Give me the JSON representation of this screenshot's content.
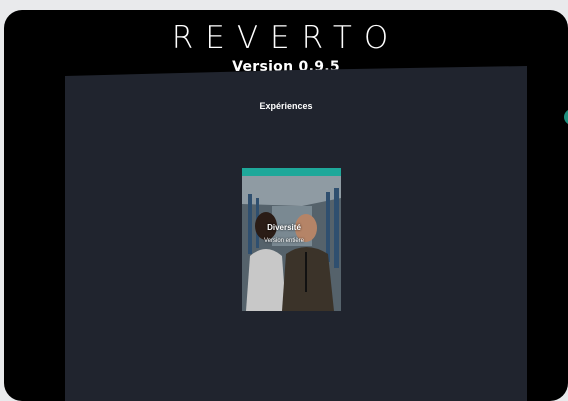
{
  "header": {
    "logo_text": "REVERTO",
    "version": "Version 0.9.5"
  },
  "panel": {
    "title": "Expériences"
  },
  "experience_card": {
    "title": "Diversité",
    "subtitle": "Version entière",
    "accent_color": "#1ea89a"
  },
  "colors": {
    "background": "#000000",
    "panel": "#20242e",
    "side_indicator": "#1f8f7e"
  }
}
